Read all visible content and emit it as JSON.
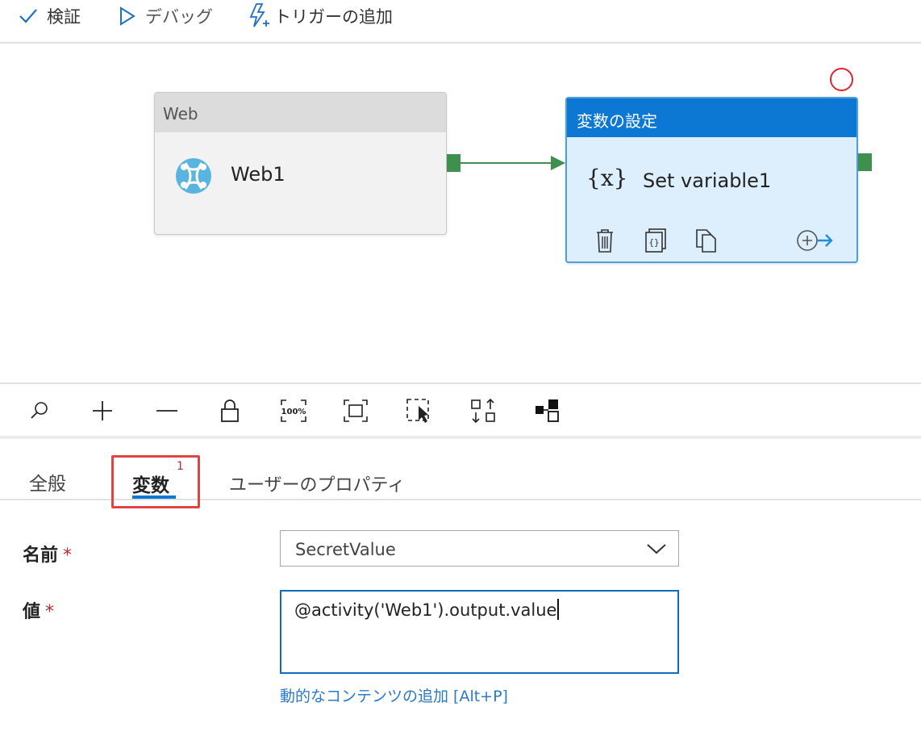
{
  "toolbar": {
    "validate_label": "検証",
    "debug_label": "デバッグ",
    "add_trigger_label": "トリガーの追加"
  },
  "canvas": {
    "web_activity": {
      "header": "Web",
      "name": "Web1",
      "icon": "web-globe-icon"
    },
    "set_variable_activity": {
      "header": "変数の設定",
      "fx_symbol": "{x}",
      "name": "Set variable1",
      "actions": [
        "delete-icon",
        "code-icon",
        "copy-icon",
        "add-output-icon"
      ]
    },
    "accent_color": "#0c78d4",
    "port_color": "#3f8f4e"
  },
  "canvas_controls": [
    "search-icon",
    "zoom-in-icon",
    "zoom-out-icon",
    "lock-icon",
    "zoom-100-icon",
    "fit-to-screen-icon",
    "select-icon",
    "auto-align-icon",
    "layout-icon"
  ],
  "zoom_label": "100%",
  "tabs": {
    "general": "全般",
    "variables": "変数",
    "variables_badge": "1",
    "user_properties": "ユーザーのプロパティ"
  },
  "form": {
    "name_label": "名前",
    "value_label": "値",
    "required_mark": "*",
    "name_value": "SecretValue",
    "value_text": "@activity('Web1').output.value",
    "dynamic_content_link": "動的なコンテンツの追加 [Alt+P]"
  }
}
